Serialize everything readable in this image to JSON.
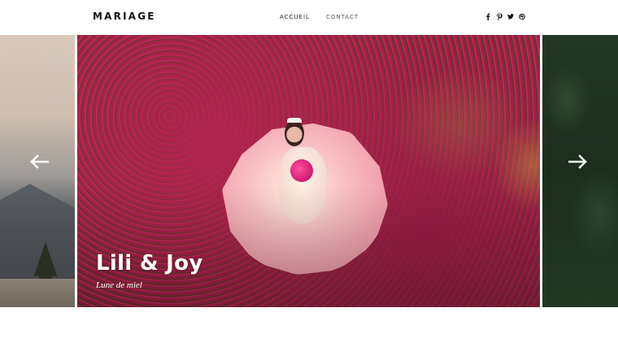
{
  "header": {
    "logo": "MARIAGE",
    "nav": [
      {
        "label": "ACCUEIL"
      },
      {
        "label": "CONTACT"
      }
    ],
    "social_icons": [
      "facebook-icon",
      "pinterest-icon",
      "twitter-icon",
      "dribbble-icon"
    ]
  },
  "slider": {
    "current": {
      "title": "Lili & Joy",
      "subtitle": "Lune de miel"
    },
    "prev_icon": "arrow-left-icon",
    "next_icon": "arrow-right-icon"
  }
}
